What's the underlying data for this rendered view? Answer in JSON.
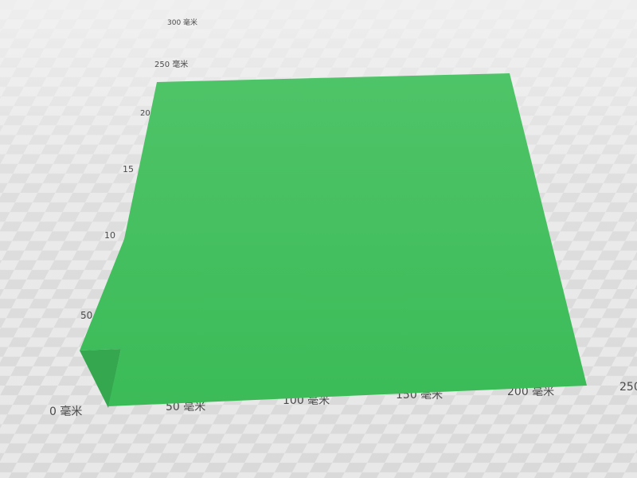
{
  "viewer": {
    "unit": "毫米",
    "background_color": "#e6e6e6",
    "grid_color": "#d8d8d8",
    "model_color": "#3dbd5a",
    "model_shade_color": "#4fc468"
  },
  "grid": {
    "y_axis_labels": [
      {
        "text": "300 毫米"
      },
      {
        "text": "250 毫米"
      },
      {
        "text": "20"
      },
      {
        "text": "15"
      },
      {
        "text": "10"
      },
      {
        "text": "50"
      },
      {
        "text": "0 毫米"
      }
    ],
    "x_axis_labels": [
      {
        "text": "50 毫米"
      },
      {
        "text": "100 毫米"
      },
      {
        "text": "150 毫米"
      },
      {
        "text": "200 毫米"
      },
      {
        "text": "250"
      }
    ]
  },
  "model": {
    "name_icon": "flat-plate-model"
  }
}
